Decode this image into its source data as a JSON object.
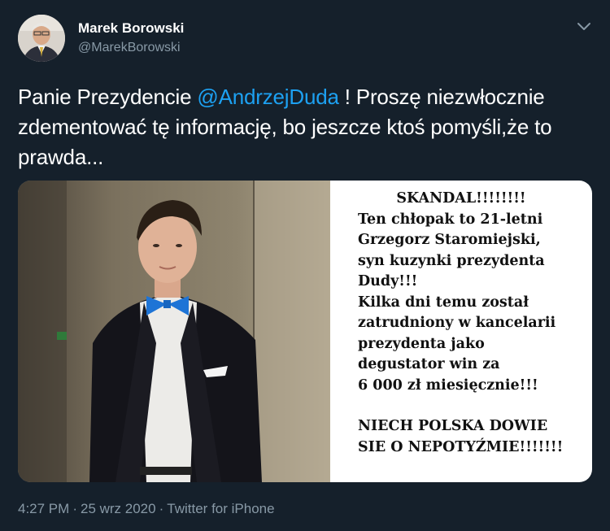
{
  "author": {
    "name": "Marek Borowski",
    "handle": "@MarekBorowski"
  },
  "tweet": {
    "text_before": "Panie Prezydencie ",
    "mention": "@AndrzejDuda",
    "text_after": " ! Proszę niezwłocznie zdementować tę informację, bo jeszcze ktoś pomyśli,że to prawda..."
  },
  "media": {
    "meme_lines": [
      "SKANDAL!!!!!!!!",
      "Ten chłopak to 21-letni",
      "Grzegorz Staromiejski,",
      "syn kuzynki prezydenta",
      "Dudy!!!",
      "Kilka dni temu został",
      "zatrudniony w kancelarii",
      "prezydenta jako",
      "degustator win za",
      "6 000 zł miesięcznie!!!",
      "NIECH POLSKA DOWIE",
      "SIE O NEPOTYŹMIE!!!!!!!"
    ]
  },
  "meta": {
    "time": "4:27 PM",
    "date": "25 wrz 2020",
    "client": "Twitter for iPhone",
    "separator": "·"
  },
  "icons": {
    "menu": "chevron-down-icon",
    "avatar": "avatar"
  },
  "colors": {
    "background": "#15202b",
    "text": "#ffffff",
    "secondary": "#8899a6",
    "accent": "#1da1f2"
  }
}
